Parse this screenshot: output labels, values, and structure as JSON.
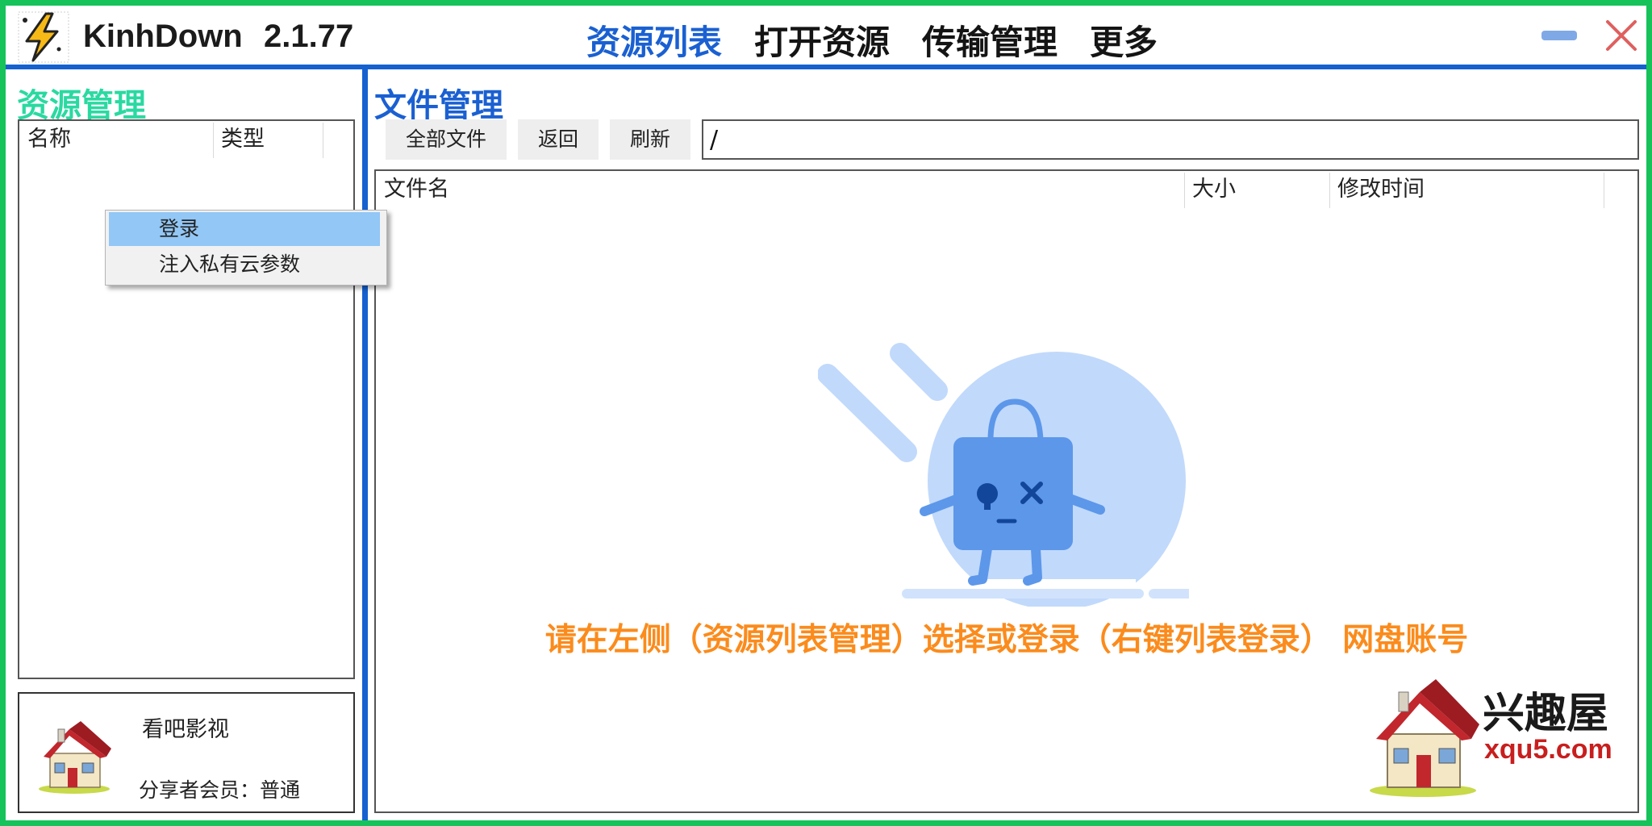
{
  "app": {
    "name": "KinhDown",
    "version": "2.1.77"
  },
  "menu": [
    {
      "label": "资源列表",
      "active": true
    },
    {
      "label": "打开资源",
      "active": false
    },
    {
      "label": "传输管理",
      "active": false
    },
    {
      "label": "更多",
      "active": false
    }
  ],
  "window_controls": {
    "minimize": "minimize-icon",
    "close": "close-icon"
  },
  "left": {
    "title": "资源管理",
    "columns": [
      "名称",
      "类型"
    ],
    "account": {
      "name": "看吧影视",
      "member": "分享者会员：普通",
      "avatar": "house-icon"
    }
  },
  "context_menu": {
    "items": [
      {
        "label": "登录",
        "highlighted": true
      },
      {
        "label": "注入私有云参数",
        "highlighted": false
      }
    ]
  },
  "right": {
    "title": "文件管理",
    "buttons": [
      "全部文件",
      "返回",
      "刷新"
    ],
    "path": "/",
    "columns": [
      "文件名",
      "大小",
      "修改时间"
    ],
    "empty_message": "请在左侧（资源列表管理）选择或登录（右键列表登录） 网盘账号"
  },
  "watermark": {
    "text": "兴趣屋",
    "url": "xqu5.com"
  },
  "colors": {
    "frame": "#16c35a",
    "accent": "#1561d0",
    "menu_active": "#1a60d2",
    "left_title": "#2ad9a1",
    "empty_message": "#fb8b1c",
    "context_highlight": "#92c7f6"
  }
}
